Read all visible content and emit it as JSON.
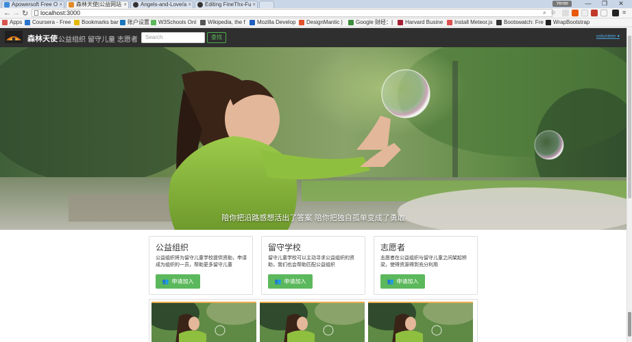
{
  "browser": {
    "tabs": [
      {
        "label": "Apowersoft Free O",
        "color": "#3b8ad9"
      },
      {
        "label": "森林天使|公益网站",
        "color": "#e08a2a"
      },
      {
        "label": "Angels-and-Love/a",
        "color": "#333333"
      },
      {
        "label": "Editing FineThx-Fu",
        "color": "#333333"
      }
    ],
    "user_badge": "Yente",
    "window_controls": [
      "—",
      "❐",
      "✕"
    ],
    "url": "localhost:3000",
    "bookmarks": [
      {
        "label": "Apps",
        "color": "#d9534f"
      },
      {
        "label": "Coursera - Free",
        "color": "#2a73cc"
      },
      {
        "label": "Bookmarks bar",
        "color": "#e6b800"
      },
      {
        "label": "账户设置",
        "color": "#1a75bc"
      },
      {
        "label": "W3Schools Onl",
        "color": "#5cb85c"
      },
      {
        "label": "Wikipedia, the f",
        "color": "#555555"
      },
      {
        "label": "Mozilla Develop",
        "color": "#1f5fbf"
      },
      {
        "label": "DesignMantic |",
        "color": "#e0502a"
      },
      {
        "label": "Google 财经：|",
        "color": "#3c8d3c"
      },
      {
        "label": "Harvard Busine",
        "color": "#a41e34"
      },
      {
        "label": "Install Meteor.js",
        "color": "#de4f4f"
      },
      {
        "label": "Bootswatch: Fre",
        "color": "#333333"
      },
      {
        "label": "WrapBootstrap",
        "color": "#222222"
      }
    ]
  },
  "site": {
    "brand": "森林天使",
    "nav": [
      "公益组织",
      "留守儿童",
      "志愿者"
    ],
    "search_placeholder": "Search",
    "search_button": "查找",
    "volunteer_link": "volunteer ▾",
    "hero_caption": "陪你把沿路感想活出了答案 陪你把独自孤单变成了勇敢",
    "panels": [
      {
        "title": "公益组织",
        "text": "公益组织将为留守儿童学校提供资助，申请成为组织的一员，帮助更多留守儿童",
        "button": "申请加入"
      },
      {
        "title": "留守学校",
        "text": "留守儿童学校可以主动寻求公益组织的资助，我们也会帮助匹配公益组织",
        "button": "申请加入"
      },
      {
        "title": "志愿者",
        "text": "志愿者在公益组织与留守儿童之间架起桥梁，使得资源得到充分利用",
        "button": "申请加入"
      }
    ],
    "accent_green": "#5cb85c",
    "navbar_color": "#2f2f2f"
  }
}
